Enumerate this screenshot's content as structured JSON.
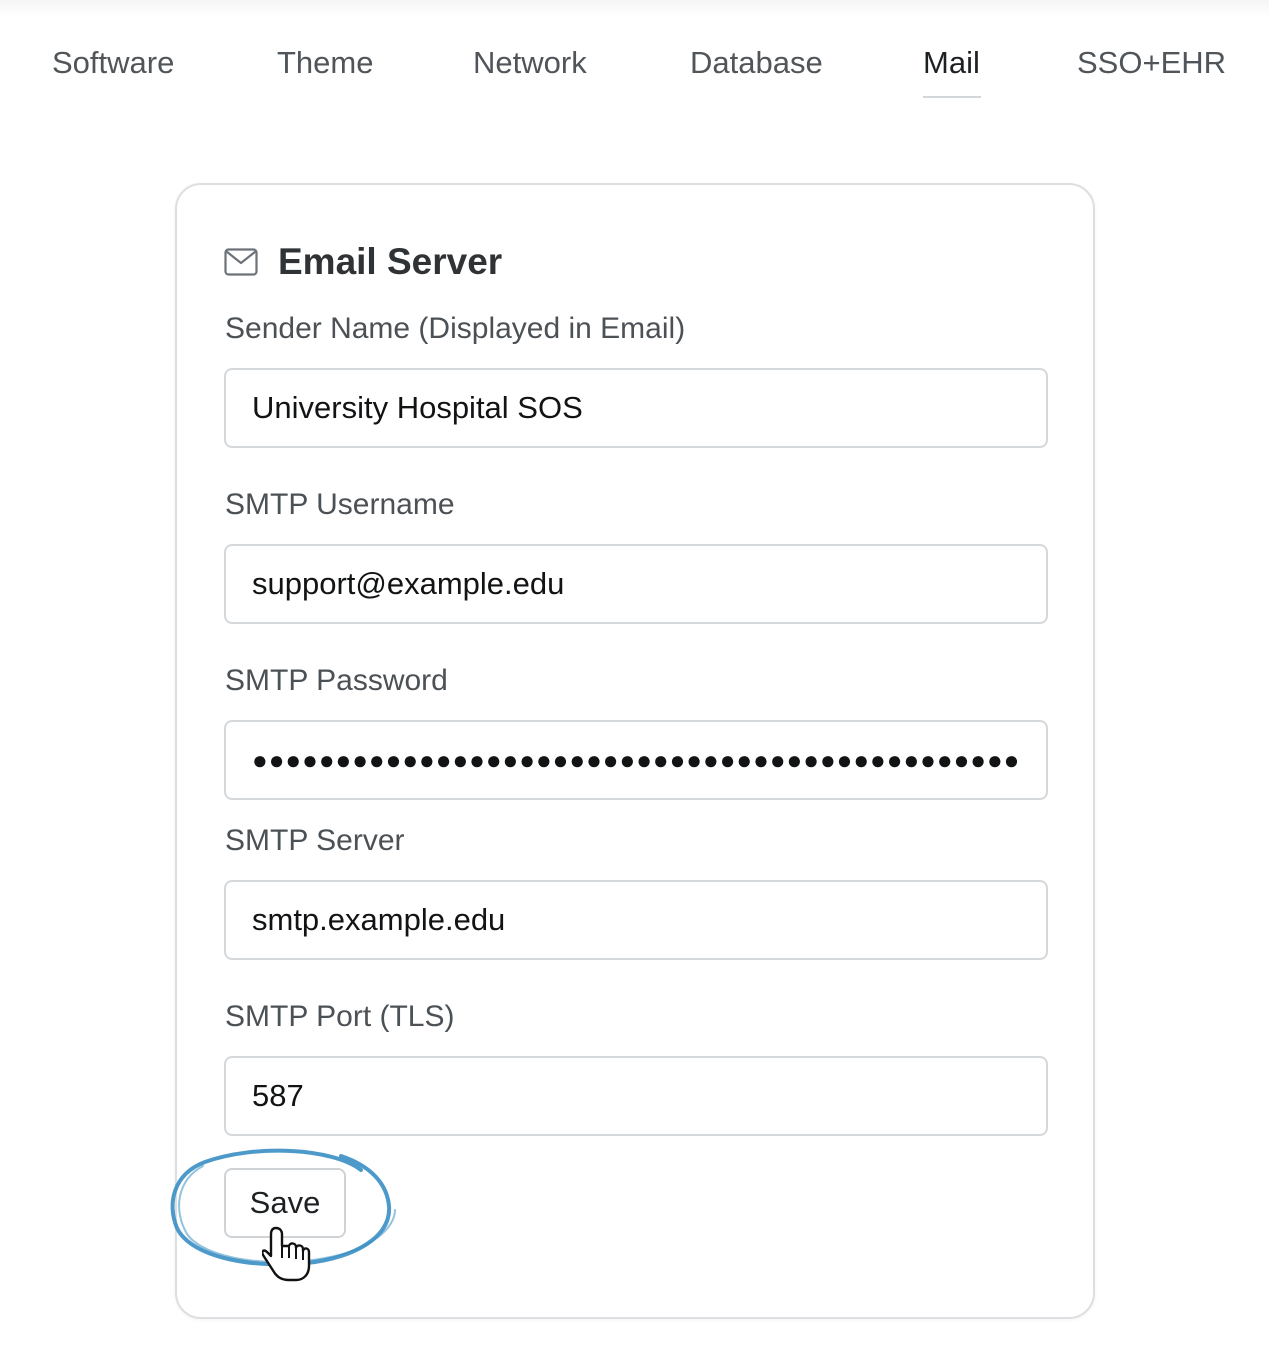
{
  "tabs": [
    {
      "label": "Software"
    },
    {
      "label": "Theme"
    },
    {
      "label": "Network"
    },
    {
      "label": "Database"
    },
    {
      "label": "Mail",
      "active": true
    },
    {
      "label": "SSO+EHR"
    }
  ],
  "card": {
    "icon": "mail-envelope-icon",
    "title": "Email Server",
    "fields": [
      {
        "label": "Sender Name (Displayed in Email)",
        "value": "University Hospital SOS"
      },
      {
        "label": "SMTP Username",
        "value": "support@example.edu"
      },
      {
        "label": "SMTP Password",
        "value": "●●●●●●●●●●●●●●●●●●●●●●●●●●●●●●●●●●●●●●●●●●●●●●●●●●"
      },
      {
        "label": "SMTP Server",
        "value": "smtp.example.edu"
      },
      {
        "label": "SMTP Port (TLS)",
        "value": "587"
      }
    ],
    "save_label": "Save"
  },
  "annotation": {
    "ring_color": "#3a8fc4",
    "cursor_icon": "hand-pointer-icon"
  }
}
